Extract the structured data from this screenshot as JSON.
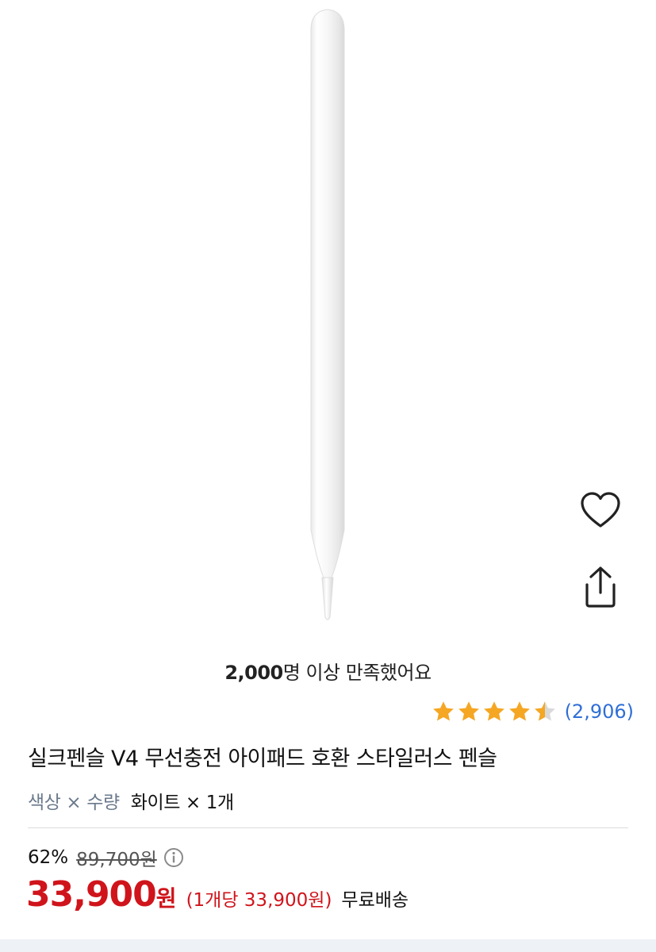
{
  "product": {
    "image_alt": "white stylus pen",
    "satisfaction_count": "2,000",
    "satisfaction_text": "명 이상 만족했어요",
    "rating": 4.5,
    "review_count": "(2,906)",
    "title": "실크펜슬 V4 무선충전 아이패드 호환 스타일러스 펜슬",
    "option_label": "색상 × 수량",
    "option_value": "화이트 × 1개",
    "discount_percent": "62%",
    "original_price": "89,700원",
    "price": "33,900",
    "price_unit": "원",
    "unit_price": "(1개당 33,900원)",
    "shipping": "무료배송"
  },
  "actions": {
    "wishlist_icon": "heart-icon",
    "share_icon": "share-icon"
  },
  "colors": {
    "price_red": "#d0141b",
    "star_gold": "#f5a623",
    "review_blue": "#2f6fd6",
    "option_gray": "#6b7a8c"
  }
}
